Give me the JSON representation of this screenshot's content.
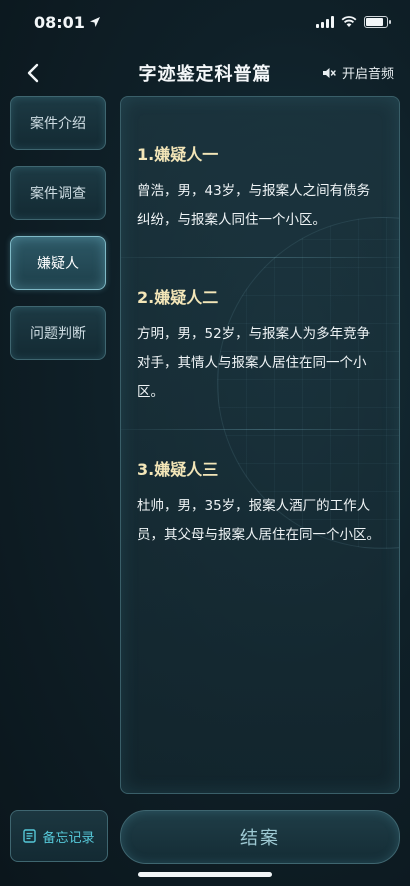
{
  "status_bar": {
    "time": "08:01"
  },
  "header": {
    "title": "字迹鉴定科普篇",
    "audio_label": "开启音频"
  },
  "sidebar": {
    "items": [
      {
        "label": "案件介绍",
        "active": false
      },
      {
        "label": "案件调查",
        "active": false
      },
      {
        "label": "嫌疑人",
        "active": true
      },
      {
        "label": "问题判断",
        "active": false
      }
    ]
  },
  "suspects": [
    {
      "title": "1.嫌疑人一",
      "description": "曾浩，男，43岁，与报案人之间有债务纠纷，与报案人同住一个小区。"
    },
    {
      "title": "2.嫌疑人二",
      "description": "方明，男，52岁，与报案人为多年竞争对手，其情人与报案人居住在同一个小区。"
    },
    {
      "title": "3.嫌疑人三",
      "description": "杜帅，男，35岁，报案人酒厂的工作人员，其父母与报案人居住在同一个小区。"
    }
  ],
  "footer": {
    "memo_label": "备忘记录",
    "close_case_label": "结案"
  },
  "colors": {
    "background": "#0d1a22",
    "panel_border": "#3a5f69",
    "title_accent": "#f3e6b8",
    "memo_accent": "#56c8d8"
  }
}
